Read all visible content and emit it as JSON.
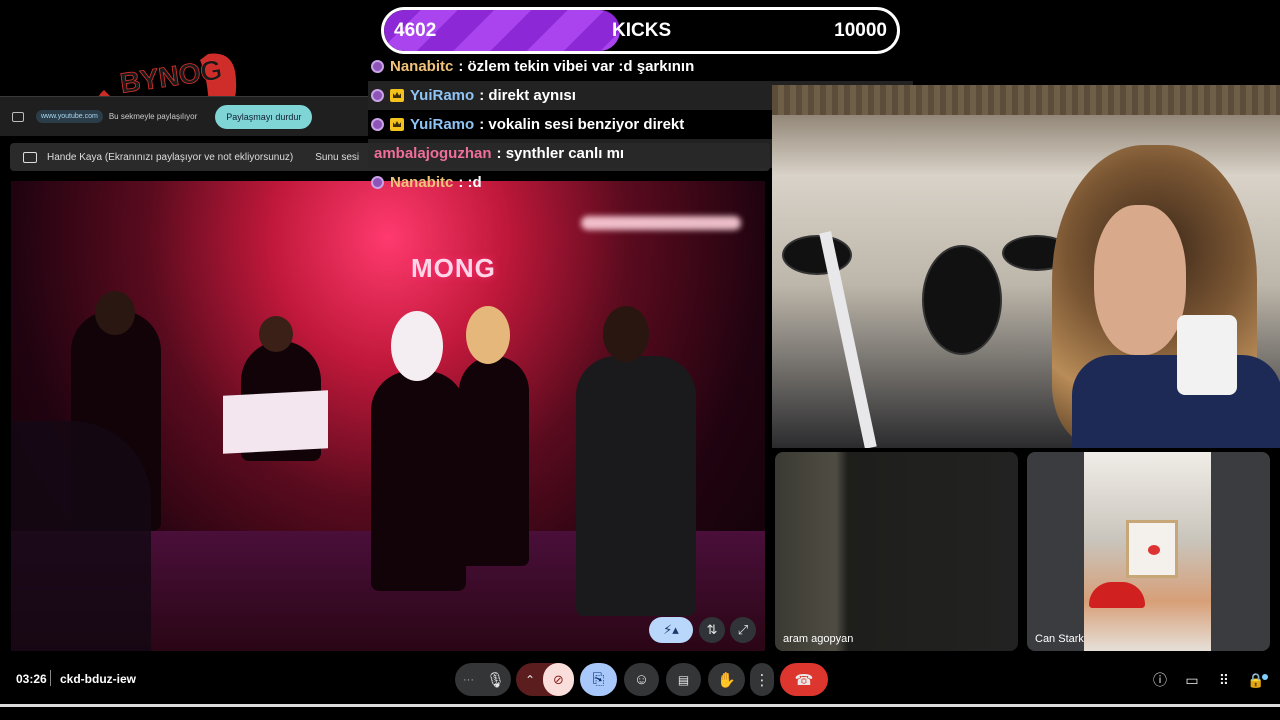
{
  "kicks": {
    "current": "4602",
    "label": "KICKS",
    "goal": "10000",
    "progress": 0.4602
  },
  "logo": {
    "text": "BYNOG"
  },
  "share_bar": {
    "url": "www.youtube.com",
    "text": "Bu sekmeyle paylaşılıyor",
    "stop_label": "Paylaşmayı durdur"
  },
  "present_bar": {
    "text": "Hande Kaya (Ekranınızı paylaşıyor ve not ekliyorsunuz)",
    "audio_label": "Sunu sesi"
  },
  "chat": [
    {
      "user": "Nanabitc",
      "badge": "purple",
      "text": ": özlem tekin vibei var :d şarkının"
    },
    {
      "user": "YuiRamo",
      "badge": "purple+crown",
      "text": ": direkt aynısı"
    },
    {
      "user": "YuiRamo",
      "badge": "purple+crown",
      "text": ": vokalin sesi benziyor direkt"
    },
    {
      "user": "ambalajoguzhan",
      "badge": "none",
      "text": ": synthler canlı mı"
    },
    {
      "user": "Nanabitc",
      "badge": "purple",
      "text": ": :d"
    }
  ],
  "video": {
    "venue_sign": "MONG"
  },
  "participants": [
    {
      "name": "aram agopyan"
    },
    {
      "name": "Can Stark"
    }
  ],
  "meeting": {
    "time": "03:26",
    "code": "ckd-bduz-iew"
  },
  "colors": {
    "kicks_fill": "#9b3ae6",
    "end_call": "#dc362e",
    "present_active": "#a8c7fa",
    "camera_off": "#f9dedc",
    "stop_share": "#7fd4d6"
  }
}
